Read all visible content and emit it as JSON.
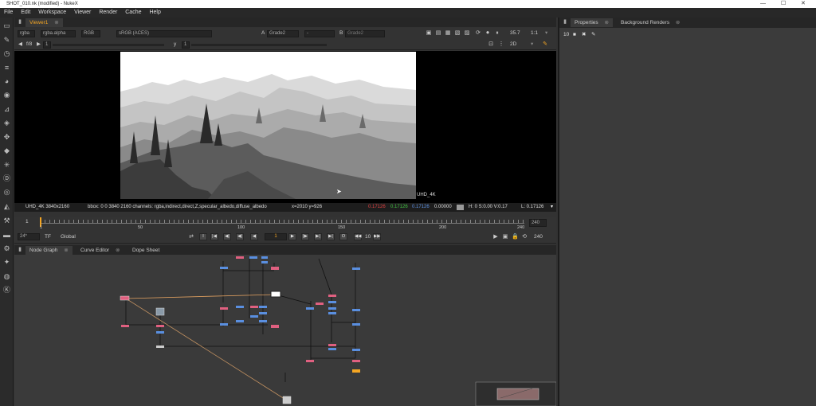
{
  "window": {
    "title": "SHOT_010.nk (modified) - NukeX",
    "controls": [
      "—",
      "☐",
      "✕"
    ]
  },
  "menu": [
    "File",
    "Edit",
    "Workspace",
    "Viewer",
    "Render",
    "Cache",
    "Help"
  ],
  "viewer": {
    "tab": "Viewer1",
    "tab_close": "⊗",
    "channels": "rgba",
    "alpha": "rgba.alpha",
    "display_mode": "RGB",
    "colorspace": "sRGB (ACES)",
    "input_a_label": "A",
    "input_a": "Grade2",
    "input_dash": "-",
    "input_b_label": "B",
    "input_b": "Grade2",
    "fstop": "f/8",
    "gain_value": "1",
    "gamma_label": "y",
    "gamma_value": "1",
    "zoom": "35.7",
    "ratio": "1:1",
    "view_mode": "2D",
    "format_label": "UHD_4K"
  },
  "info": {
    "format": "UHD_4K 3840x2160",
    "bbox": "bbox: 0 0 3840 2160 channels: rgba,indirect,direct,Z,specular_albedo,diffuse_albedo",
    "coords": "x=2010 y=926",
    "r": "0.17126",
    "g": "0.17126",
    "b": "0.17126",
    "a": "0.00000",
    "hsv": "H:   0 S:0.00 V:0.17",
    "luma": "L:  0.17126",
    "colors": {
      "r": "#e04040",
      "g": "#40c040",
      "b": "#5a8fe0"
    }
  },
  "timeline": {
    "start": "1",
    "end": "240",
    "ticks": [
      "1",
      "50",
      "100",
      "150",
      "200",
      "240"
    ],
    "end_field": "240"
  },
  "playback": {
    "fps": "24*",
    "tf": "TF",
    "scope": "Global",
    "frame": "1",
    "step": "10",
    "end_frame": "240"
  },
  "panels": {
    "tabs": [
      "Node Graph",
      "Curve Editor",
      "Dope Sheet"
    ],
    "tab_close": "⊗"
  },
  "properties": {
    "tabs": [
      "Properties",
      "Background Renders"
    ],
    "max_panels": "10"
  },
  "toolbar_icons": [
    "image-icon",
    "draw-icon",
    "time-icon",
    "channel-icon",
    "color-icon",
    "filter-icon",
    "keyer-icon",
    "merge-icon",
    "transform-icon",
    "3d-icon",
    "particles-icon",
    "deep-icon",
    "views-icon",
    "metadata-icon",
    "toolsets-icon",
    "other-icon",
    "furnace-icon",
    "ocula-icon",
    "cara-icon",
    "nuke-icon"
  ]
}
